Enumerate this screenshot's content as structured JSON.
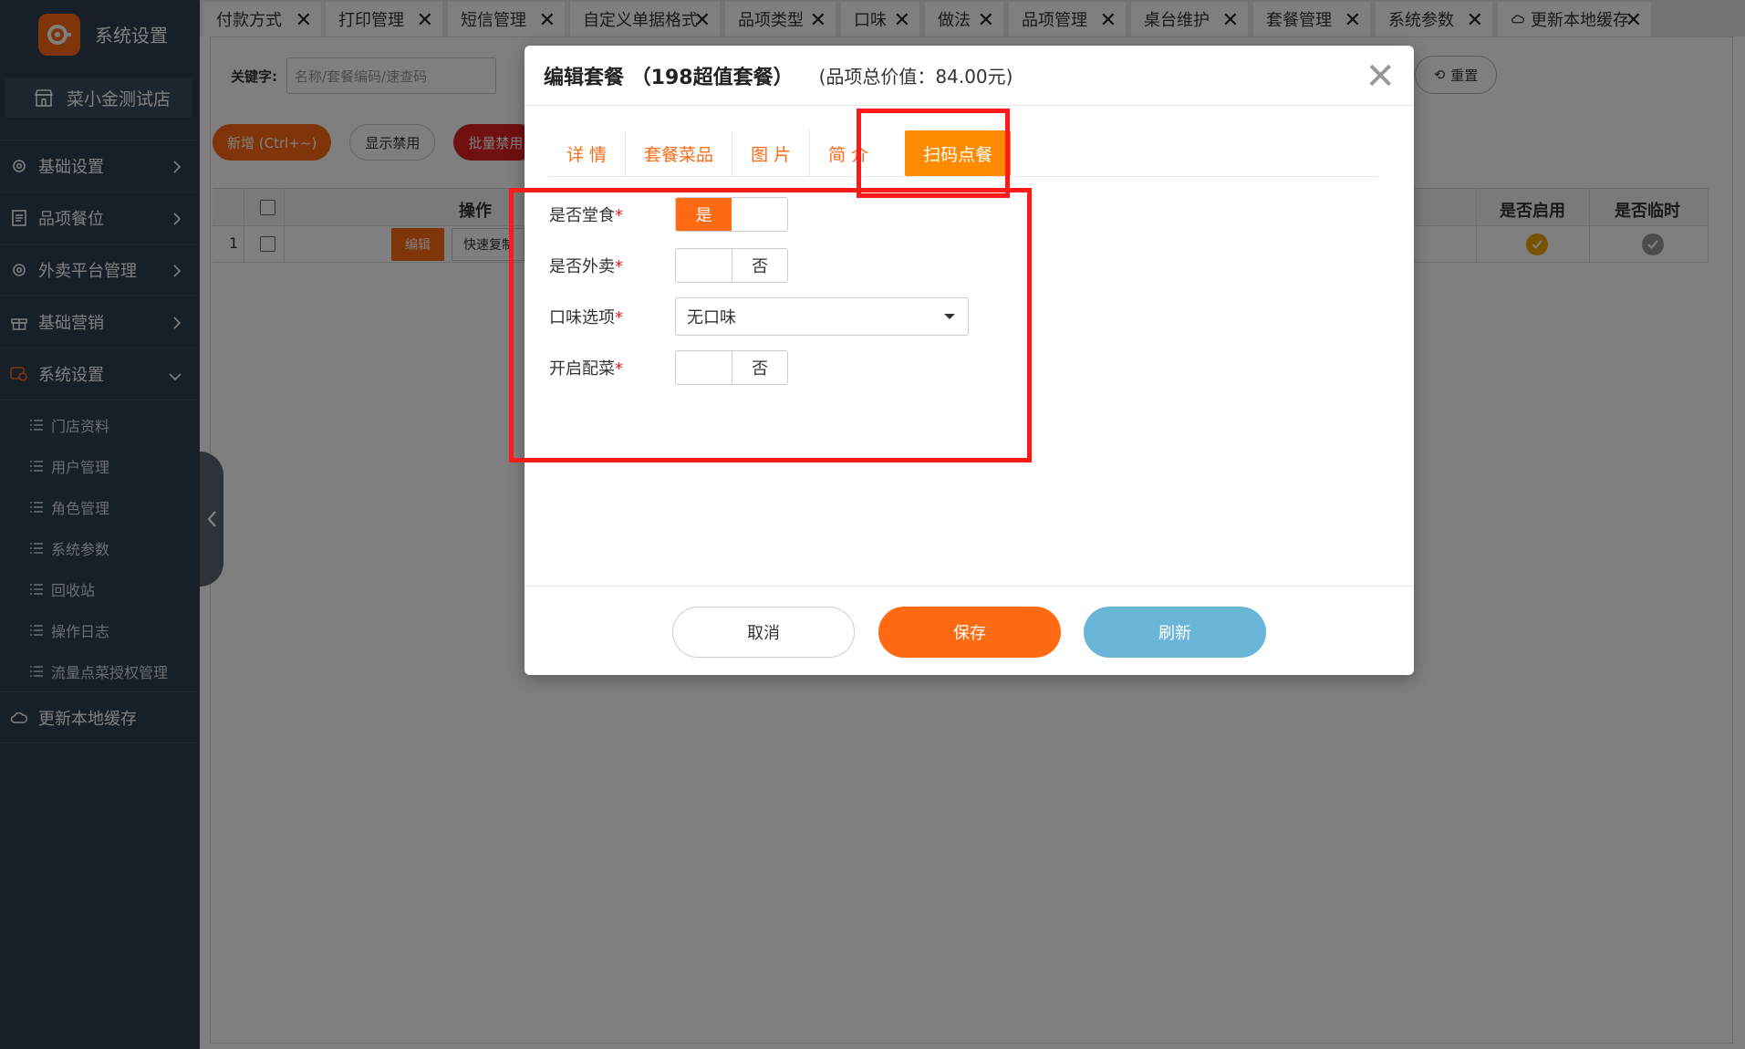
{
  "sidebar": {
    "title": "系统设置",
    "store": "菜小金测试店",
    "menu": [
      {
        "label": "基础设置",
        "icon": "gear-icon"
      },
      {
        "label": "品项餐位",
        "icon": "list-icon"
      },
      {
        "label": "外卖平台管理",
        "icon": "gear-icon"
      },
      {
        "label": "基础营销",
        "icon": "gift-icon"
      }
    ],
    "active_menu": "系统设置",
    "sub_items": [
      "门店资料",
      "用户管理",
      "角色管理",
      "系统参数",
      "回收站",
      "操作日志",
      "流量点菜授权管理"
    ],
    "bottom_item": "更新本地缓存"
  },
  "tabs": [
    "付款方式",
    "打印管理",
    "短信管理",
    "自定义单据格式",
    "品项类型",
    "口味",
    "做法",
    "品项管理",
    "桌台维护",
    "套餐管理",
    "系统参数",
    "更新本地缓存"
  ],
  "active_tab": "套餐管理",
  "search": {
    "label": "关键字:",
    "placeholder": "名称/套餐编码/速查码",
    "reset": "重置"
  },
  "toolbar": {
    "add": "新增 (Ctrl+~)",
    "show_disabled": "显示禁用",
    "batch_disable": "批量禁用"
  },
  "grid": {
    "headers": {
      "op": "操作",
      "enabled": "是否启用",
      "temp": "是否临时"
    },
    "row": {
      "index": "1",
      "edit": "编辑",
      "copy": "快速复制"
    }
  },
  "modal": {
    "title": "编辑套餐 （198超值套餐）",
    "subtitle": "(品项总价值：84.00元)",
    "tabs": [
      "详 情",
      "套餐菜品",
      "图 片",
      "简 介"
    ],
    "active_tab": "扫码点餐",
    "form": {
      "dine_in": {
        "label": "是否堂食",
        "value": "是"
      },
      "takeout": {
        "label": "是否外卖",
        "value": "否"
      },
      "flavor": {
        "label": "口味选项",
        "value": "无口味"
      },
      "side_dish": {
        "label": "开启配菜",
        "value": "否"
      }
    },
    "buttons": {
      "cancel": "取消",
      "save": "保存",
      "refresh": "刷新"
    }
  },
  "colors": {
    "accent": "#ff6a13",
    "sidebar": "#2f3e50",
    "highlight": "#ff1a1a",
    "refresh": "#6ab6d8"
  }
}
